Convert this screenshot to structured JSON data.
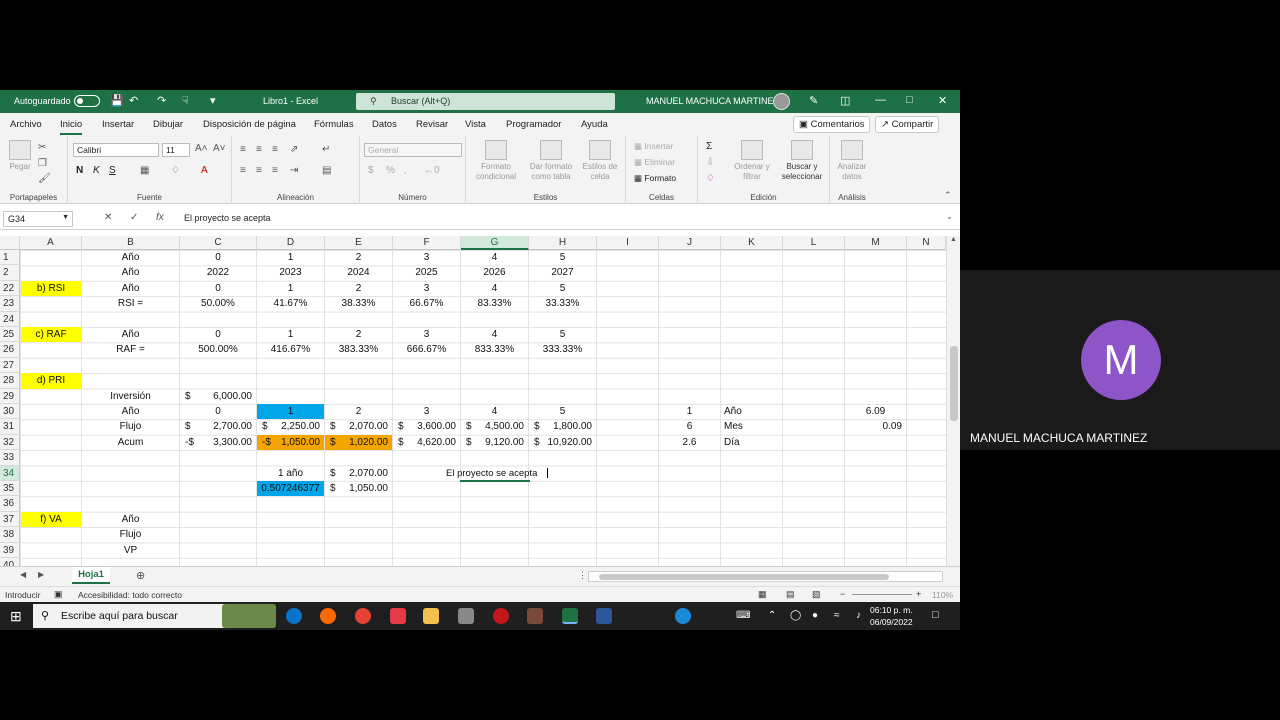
{
  "titlebar": {
    "autosave": "Autoguardado",
    "filename": "Libro1 - Excel",
    "search": "Buscar (Alt+Q)",
    "user": "MANUEL MACHUCA MARTINEZ"
  },
  "menu": {
    "tabs": [
      "Archivo",
      "Inicio",
      "Insertar",
      "Dibujar",
      "Disposición de página",
      "Fórmulas",
      "Datos",
      "Revisar",
      "Vista",
      "Programador",
      "Ayuda"
    ],
    "comments": "Comentarios",
    "share": "Compartir"
  },
  "ribbon": {
    "paste": "Pegar",
    "font_name": "Calibri",
    "font_size": "11",
    "number_format": "General",
    "cond_format": "Formato condicional",
    "table_format": "Dar formato como tabla",
    "cell_styles": "Estilos de celda",
    "insert": "Insertar",
    "delete": "Eliminar",
    "format": "Formato",
    "sort": "Ordenar y filtrar",
    "find": "Buscar y seleccionar",
    "analyze": "Analizar datos",
    "groups": {
      "clipboard": "Portapapeles",
      "font": "Fuente",
      "alignment": "Alineación",
      "number": "Número",
      "styles": "Estilos",
      "cells": "Celdas",
      "editing": "Edición",
      "analysis": "Análisis"
    }
  },
  "formula_bar": {
    "name_box": "G34",
    "content": "El proyecto se acepta"
  },
  "columns": [
    "A",
    "B",
    "C",
    "D",
    "E",
    "F",
    "G",
    "H",
    "I",
    "J",
    "K",
    "L",
    "M",
    "N"
  ],
  "rows": [
    "1",
    "2",
    "22",
    "23",
    "24",
    "25",
    "26",
    "27",
    "28",
    "29",
    "30",
    "31",
    "32",
    "33",
    "34",
    "35",
    "36",
    "37",
    "38",
    "39",
    "40"
  ],
  "sheet": {
    "r1": {
      "B": "Año",
      "C": "0",
      "D": "1",
      "E": "2",
      "F": "3",
      "G": "4",
      "H": "5"
    },
    "r2": {
      "B": "Año",
      "C": "2022",
      "D": "2023",
      "E": "2024",
      "F": "2025",
      "G": "2026",
      "H": "2027"
    },
    "r22": {
      "A": "b) RSI",
      "B": "Año",
      "C": "0",
      "D": "1",
      "E": "2",
      "F": "3",
      "G": "4",
      "H": "5"
    },
    "r23": {
      "B": "RSI =",
      "C": "50.00%",
      "D": "41.67%",
      "E": "38.33%",
      "F": "66.67%",
      "G": "83.33%",
      "H": "33.33%"
    },
    "r25": {
      "A": "c) RAF",
      "B": "Año",
      "C": "0",
      "D": "1",
      "E": "2",
      "F": "3",
      "G": "4",
      "H": "5"
    },
    "r26": {
      "B": "RAF =",
      "C": "500.00%",
      "D": "416.67%",
      "E": "383.33%",
      "F": "666.67%",
      "G": "833.33%",
      "H": "333.33%"
    },
    "r28": {
      "A": "d) PRI"
    },
    "r29": {
      "B": "Inversión",
      "C": "6,000.00"
    },
    "r30": {
      "B": "Año",
      "C": "0",
      "D": "1",
      "E": "2",
      "F": "3",
      "G": "4",
      "H": "5",
      "J": "1",
      "K": "Año",
      "M": "6.09"
    },
    "r31": {
      "B": "Flujo",
      "C": "2,700.00",
      "D": "2,250.00",
      "E": "2,070.00",
      "F": "3,600.00",
      "G": "4,500.00",
      "H": "1,800.00",
      "J": "6",
      "K": "Mes",
      "M": "0.09"
    },
    "r32": {
      "B": "Acum",
      "C": "3,300.00",
      "D": "1,050.00",
      "E": "1,020.00",
      "F": "4,620.00",
      "G": "9,120.00",
      "H": "10,920.00",
      "J": "2.6",
      "K": "Día"
    },
    "r34": {
      "D": "1 año",
      "E": "2,070.00",
      "G": "El proyecto se acepta"
    },
    "r35": {
      "D": "0.507246377",
      "E": "1,050.00"
    },
    "r37": {
      "A": "f) VA",
      "B": "Año"
    },
    "r38": {
      "B": "Flujo"
    },
    "r39": {
      "B": "VP"
    },
    "currency": "$",
    "neg_currency": "-$"
  },
  "sheet_tab": "Hoja1",
  "status": {
    "mode": "Introducir",
    "accessibility": "Accesibilidad: todo correcto",
    "zoom": "110%"
  },
  "taskbar": {
    "search": "Escribe aquí para buscar",
    "time": "06:10 p. m.",
    "date": "06/09/2022"
  },
  "participant": {
    "initial": "M",
    "name": "MANUEL MACHUCA MARTINEZ"
  },
  "colors": {
    "excel_green": "#1e7145",
    "highlight_yellow": "#ffff00",
    "highlight_orange": "#f4a500",
    "highlight_blue": "#00a6e8",
    "avatar": "#8e55c8"
  }
}
